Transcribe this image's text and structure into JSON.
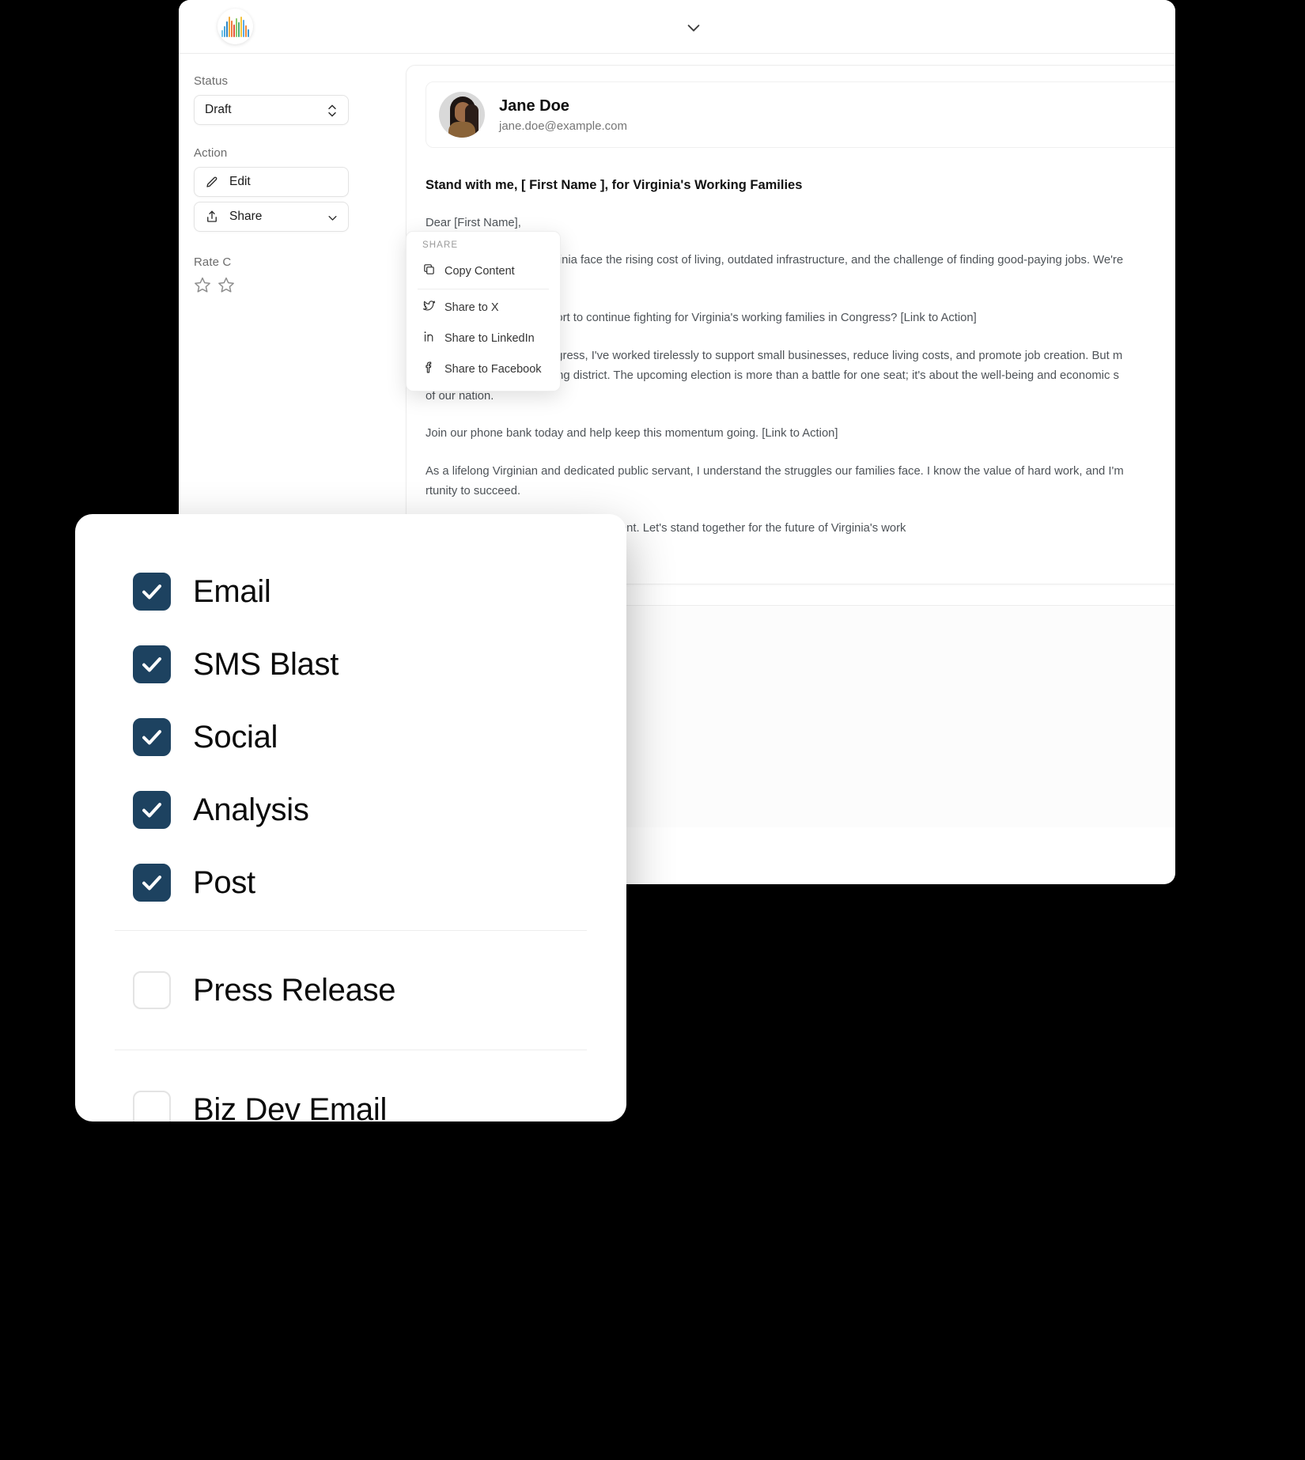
{
  "window": {
    "logo_name": "app-logo",
    "header_chevron": "chevron-down-icon"
  },
  "sidebar": {
    "status_label": "Status",
    "status_value": "Draft",
    "action_label": "Action",
    "edit_label": "Edit",
    "share_label": "Share",
    "rate_label": "Rate C",
    "star_count": 2
  },
  "share_menu": {
    "caption": "SHARE",
    "items": [
      {
        "label": "Copy Content",
        "icon": "copy-icon"
      },
      {
        "label": "Share to X",
        "icon": "twitter-x-icon"
      },
      {
        "label": "Share to LinkedIn",
        "icon": "linkedin-icon"
      },
      {
        "label": "Share to Facebook",
        "icon": "facebook-icon"
      }
    ]
  },
  "email": {
    "sender_name": "Jane Doe",
    "sender_email": "jane.doe@example.com",
    "subject": "Stand with me, [ First Name ], for Virginia's Working Families",
    "paragraphs": [
      "Dear [First Name],",
      "Every day, families in Virginia face the rising cost of living, outdated infrastructure, and the challenge of finding good-paying jobs. We're\nchange.",
      "Can I count on your support to continue fighting for Virginia's working families in Congress? [Link to Action]",
      "During my service in Congress, I've worked tirelessly to support small businesses, reduce living costs, and promote job creation. But m\nconstant threat in this swing district. The upcoming election is more than a battle for one seat; it's about the well-being and economic s\nof our nation.",
      "Join our phone bank today and help keep this momentum going. [Link to Action]",
      "As a lifelong Virginian and dedicated public servant, I understand the struggles our families face. I know the value of hard work, and I'm\nrtunity to succeed.",
      "ack into our divided political environment. Let's stand together for the future of Virginia's work"
    ]
  },
  "channels_modal": {
    "checked_items": [
      {
        "label": "Email",
        "checked": true
      },
      {
        "label": "SMS Blast",
        "checked": true
      },
      {
        "label": "Social",
        "checked": true
      },
      {
        "label": "Analysis",
        "checked": true
      },
      {
        "label": "Post",
        "checked": true
      }
    ],
    "unchecked_items": [
      {
        "label": "Press Release",
        "checked": false
      },
      {
        "label": "Biz Dev Email",
        "checked": false
      }
    ]
  },
  "colors": {
    "checkbox_on": "#1d4260",
    "checkbox_off_border": "#e4e4e4",
    "window_bg": "#ffffff",
    "page_bg": "#000000",
    "body_text": "#4e5358"
  }
}
